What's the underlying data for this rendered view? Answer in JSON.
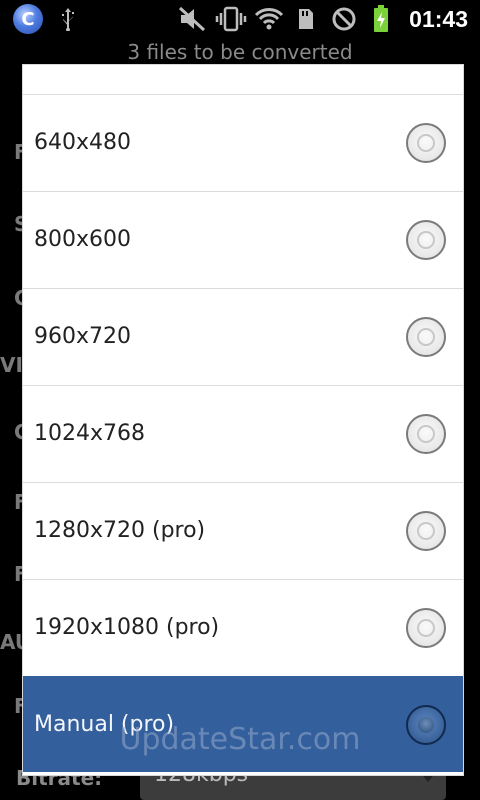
{
  "status_bar": {
    "time": "01:43",
    "icons": [
      "app-launcher-icon",
      "usb-icon",
      "mute-icon",
      "vibrate-icon",
      "wifi-icon",
      "sd-card-icon",
      "no-signal-icon",
      "battery-charging-icon"
    ]
  },
  "background": {
    "subtitle": "3 files to be converted",
    "side_letters": [
      "F",
      "S",
      "C",
      "VI",
      "C",
      "F",
      "F",
      "AU",
      "F"
    ],
    "bitrate_label": "Bitrate:",
    "bitrate_value": "128kbps"
  },
  "dialog": {
    "options": [
      {
        "label": "640x480",
        "selected": false
      },
      {
        "label": "800x600",
        "selected": false
      },
      {
        "label": "960x720",
        "selected": false
      },
      {
        "label": "1024x768",
        "selected": false
      },
      {
        "label": "1280x720 (pro)",
        "selected": false
      },
      {
        "label": "1920x1080 (pro)",
        "selected": false
      },
      {
        "label": "Manual (pro)",
        "selected": true
      }
    ]
  },
  "watermark": "UpdateStar.com",
  "colors": {
    "selected_bg": "#335f9d",
    "dialog_bg": "#ffffff",
    "status_bar_bg": "#000000",
    "battery_green": "#7ad13a"
  }
}
